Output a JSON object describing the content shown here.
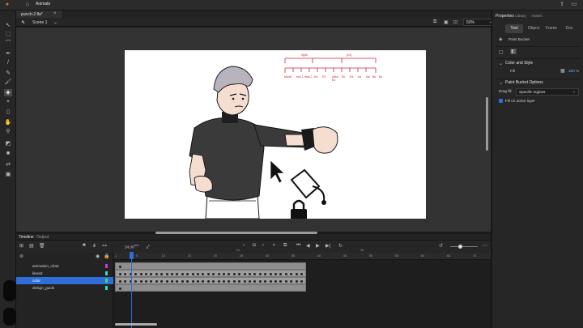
{
  "app": {
    "name": "Animate"
  },
  "document": {
    "tab_title": "punch-2.fla*",
    "scene": "Scene 1",
    "zoom": "50%"
  },
  "stage_notes": {
    "top_labels": [
      "rig4b",
      "(e4)"
    ],
    "bottom_labels": [
      "bkcs0",
      "ewi-1",
      "ekis.2",
      "-Es",
      "E2",
      "eksa",
      "Ek",
      "Ek",
      "Ea",
      "ea",
      "kia",
      "Bs",
      "Bs"
    ]
  },
  "properties": {
    "header": "Properties",
    "header_tabs": [
      "Library",
      "Assets"
    ],
    "tabs": [
      "Tool",
      "Object",
      "Frame",
      "Doc"
    ],
    "tool_name": "Paint Bucket",
    "color_style_label": "Color and Style",
    "fill_label": "Fill",
    "fill_alpha": "100",
    "fill_alpha_unit": "%",
    "options_label": "Paint Bucket Options",
    "drag_fill_label": "Drag fill",
    "drag_fill_value": "Specific regions",
    "fill_active_layer_label": "Fill on active layer"
  },
  "timeline": {
    "title": "Timeline",
    "output_tab": "Output",
    "fps": "24.00",
    "fps_unit": "FPS",
    "current_frame": "4",
    "ruler": [
      "1",
      "5",
      "10",
      "15",
      "20",
      "25",
      "30",
      "35",
      "40",
      "45",
      "50",
      "55",
      "60",
      "65",
      "70"
    ],
    "seconds": [
      "1s",
      "2s"
    ],
    "layers": [
      {
        "name": "animation_chart",
        "color": "#c43bd6",
        "selected": false
      },
      {
        "name": "lineart",
        "color": "#3cd6d0",
        "selected": false
      },
      {
        "name": "color",
        "color": "#3ce05a",
        "selected": true
      },
      {
        "name": "design_guide",
        "color": "#3cd6d0",
        "selected": false
      }
    ]
  }
}
